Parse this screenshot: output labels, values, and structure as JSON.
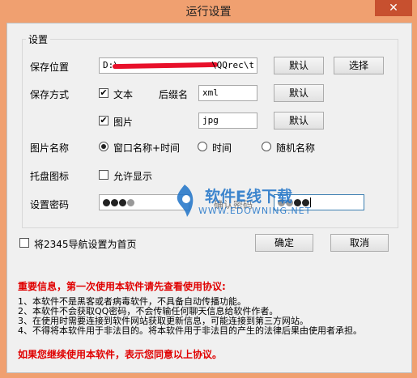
{
  "window": {
    "title": "运行设置",
    "close": "✕"
  },
  "group": {
    "title": "设置"
  },
  "save_location": {
    "label": "保存位置",
    "value": "D:\\",
    "value_tail": "\\QQrec\\t",
    "button_default": "默认",
    "button_choose": "选择"
  },
  "save_mode": {
    "label": "保存方式",
    "text_checkbox": {
      "label": "文本",
      "checked": true
    },
    "suffix_label": "后缀名",
    "suffix_value": "xml",
    "button_default": "默认",
    "image_checkbox": {
      "label": "图片",
      "checked": true
    },
    "image_suffix_value": "jpg",
    "image_button_default": "默认"
  },
  "image_name": {
    "label": "图片名称",
    "options": [
      {
        "label": "窗口名称+时间",
        "selected": true
      },
      {
        "label": "时间",
        "selected": false
      },
      {
        "label": "随机名称",
        "selected": false
      }
    ]
  },
  "tray_icon": {
    "label": "托盘图标",
    "checkbox_label": "允许显示",
    "checked": false
  },
  "password": {
    "label": "设置密码",
    "confirm_label": "确认密码"
  },
  "homepage": {
    "checkbox_label": "将2345导航设置为首页",
    "checked": false
  },
  "buttons": {
    "ok": "确定",
    "cancel": "取消"
  },
  "notice": {
    "heading": "重要信息，第一次使用本软件请先查看使用协议:",
    "lines": [
      "1、本软件不是黑客或者病毒软件，不具备自动传播功能。",
      "2、本软件不会获取QQ密码，不会传输任何聊天信息给软件作者。",
      "3、在使用时需要连接到软件网站获取更新信息，可能连接到第三方网站。",
      "4、不得将本软件用于非法目的。将本软件用于非法目的产生的法律后果由使用者承担。"
    ],
    "footer": "如果您继续使用本软件，表示您同意以上协议。"
  },
  "watermark": {
    "title": "软件E线下载",
    "url": "WWW.EDOWNING.NET"
  },
  "colors": {
    "accent": "#f0a070",
    "close": "#c7502f",
    "warning": "#e00000",
    "watermark": "#1e73c8"
  }
}
